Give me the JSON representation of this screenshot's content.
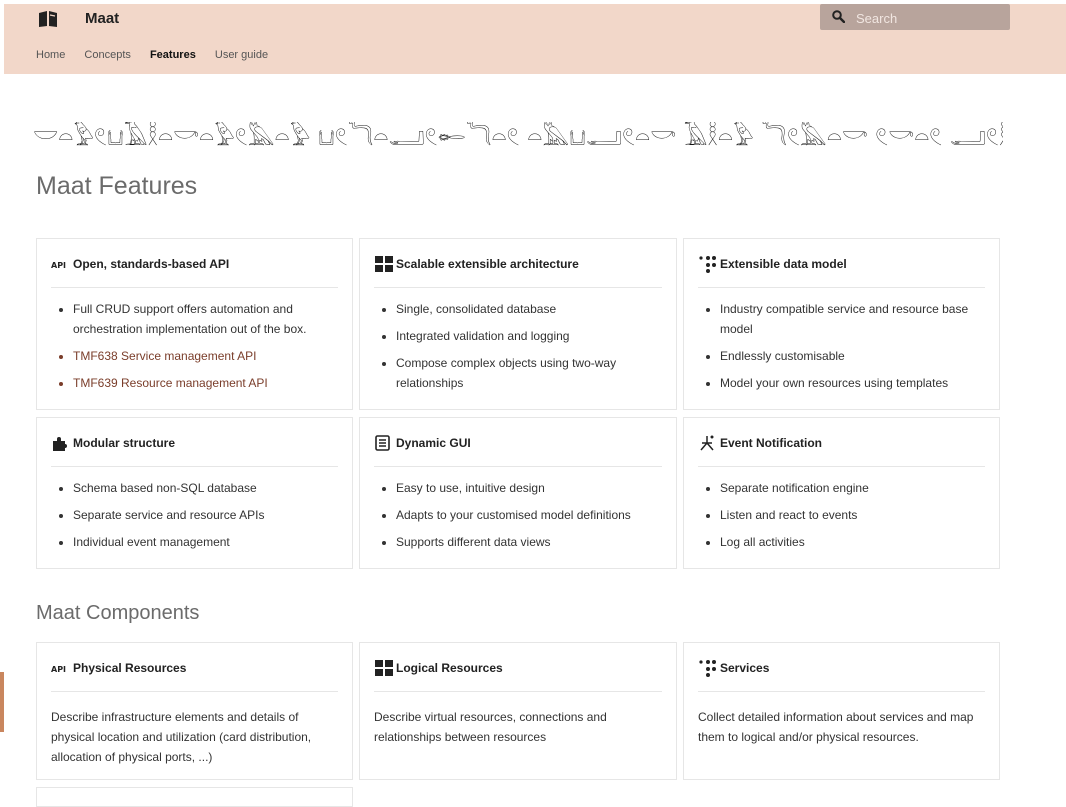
{
  "app": {
    "title": "Maat"
  },
  "nav": [
    {
      "label": "Home",
      "active": false
    },
    {
      "label": "Concepts",
      "active": false
    },
    {
      "label": "Features",
      "active": true
    },
    {
      "label": "User guide",
      "active": false
    }
  ],
  "search": {
    "placeholder": "Search"
  },
  "hieroglyph_banner": "𓎟𓏏𓅱𓏲𓂓𓄿𓎛𓏏𓎡𓏏𓅱𓏲𓅓𓏏𓅱 𓂓𓏲𓆓𓏏𓂝𓏲𓄡𓆓𓏏𓏲 𓏏𓅓𓂓𓂝𓏲𓏏𓎡 𓄿𓎛𓏏𓅱 𓆓𓏲𓅓𓏏𓎡 𓏲𓎡𓏏𓏲 𓂝𓏲𓎛𓏏𓎡",
  "features": {
    "heading": "Maat Features",
    "cards": [
      {
        "icon": "api-icon",
        "title": "Open, standards-based API",
        "items": [
          {
            "text": "Full CRUD support offers automation and orchestration implementation out of the box.",
            "link": false
          },
          {
            "text": "TMF638 Service management API",
            "link": true
          },
          {
            "text": "TMF639 Resource management API",
            "link": true
          }
        ]
      },
      {
        "icon": "architecture-icon",
        "title": "Scalable extensible architecture",
        "items": [
          {
            "text": "Single, consolidated database",
            "link": false
          },
          {
            "text": "Integrated validation and logging",
            "link": false
          },
          {
            "text": "Compose complex objects using two-way relationships",
            "link": false
          }
        ]
      },
      {
        "icon": "data-model-icon",
        "title": "Extensible data model",
        "items": [
          {
            "text": "Industry compatible service and resource base model",
            "link": false
          },
          {
            "text": "Endlessly customisable",
            "link": false
          },
          {
            "text": "Model your own resources using templates",
            "link": false
          }
        ]
      },
      {
        "icon": "puzzle-icon",
        "title": "Modular structure",
        "items": [
          {
            "text": "Schema based non-SQL database",
            "link": false
          },
          {
            "text": "Separate service and resource APIs",
            "link": false
          },
          {
            "text": "Individual event management",
            "link": false
          }
        ]
      },
      {
        "icon": "gui-icon",
        "title": "Dynamic GUI",
        "items": [
          {
            "text": "Easy to use, intuitive design",
            "link": false
          },
          {
            "text": "Adapts to your customised model definitions",
            "link": false
          },
          {
            "text": "Supports different data views",
            "link": false
          }
        ]
      },
      {
        "icon": "notification-icon",
        "title": "Event Notification",
        "items": [
          {
            "text": "Separate notification engine",
            "link": false
          },
          {
            "text": "Listen and react to events",
            "link": false
          },
          {
            "text": "Log all activities",
            "link": false
          }
        ]
      }
    ]
  },
  "components": {
    "heading": "Maat Components",
    "cards": [
      {
        "icon": "api-icon",
        "title": "Physical Resources",
        "description": "Describe infrastructure elements and details of physical location and utilization (card distribution, allocation of physical ports, ...)"
      },
      {
        "icon": "architecture-icon",
        "title": "Logical Resources",
        "description": "Describe virtual resources, connections and relationships between resources"
      },
      {
        "icon": "data-model-icon",
        "title": "Services",
        "description": "Collect detailed information about services and map them to logical and/or physical resources."
      }
    ]
  }
}
